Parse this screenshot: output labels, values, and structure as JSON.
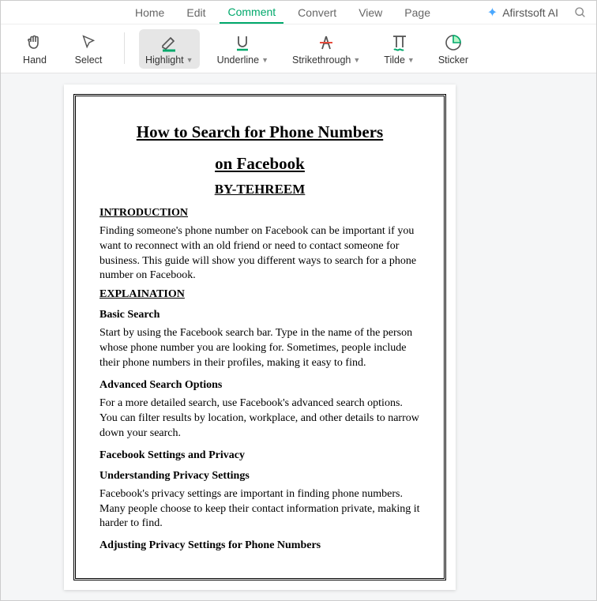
{
  "tabs": {
    "home": "Home",
    "edit": "Edit",
    "comment": "Comment",
    "convert": "Convert",
    "view": "View",
    "page": "Page"
  },
  "ai": {
    "label": "Afirstsoft AI"
  },
  "tools": {
    "hand": "Hand",
    "select": "Select",
    "highlight": "Highlight",
    "underline": "Underline",
    "strikethrough": "Strikethrough",
    "tilde": "Tilde",
    "sticker": "Sticker"
  },
  "doc": {
    "title_line1": "How to Search for Phone Numbers",
    "title_line2": "on Facebook",
    "byline": "BY-TEHREEM",
    "h_intro": "INTRODUCTION",
    "p_intro": "Finding someone's phone number on Facebook can be important if you want to reconnect with an old friend or need to contact someone for business. This guide will show you different ways to search for a phone number on Facebook.",
    "h_explain": "EXPLAINATION",
    "sub_basic": "Basic Search",
    "p_basic": "Start by using the Facebook search bar. Type in the name of the person whose phone number you are looking for. Sometimes, people include their phone numbers in their profiles, making it easy to find.",
    "sub_adv": "Advanced Search Options",
    "p_adv": "For a more detailed search, use Facebook's advanced search options. You can filter results by location, workplace, and other details to narrow down your search.",
    "sub_privacy1": "Facebook Settings and Privacy",
    "sub_privacy2": "Understanding Privacy Settings",
    "p_privacy": "Facebook's privacy settings are important in finding phone numbers. Many people choose to keep their contact information private, making it harder to find.",
    "sub_adjust": "Adjusting Privacy Settings for Phone Numbers"
  }
}
